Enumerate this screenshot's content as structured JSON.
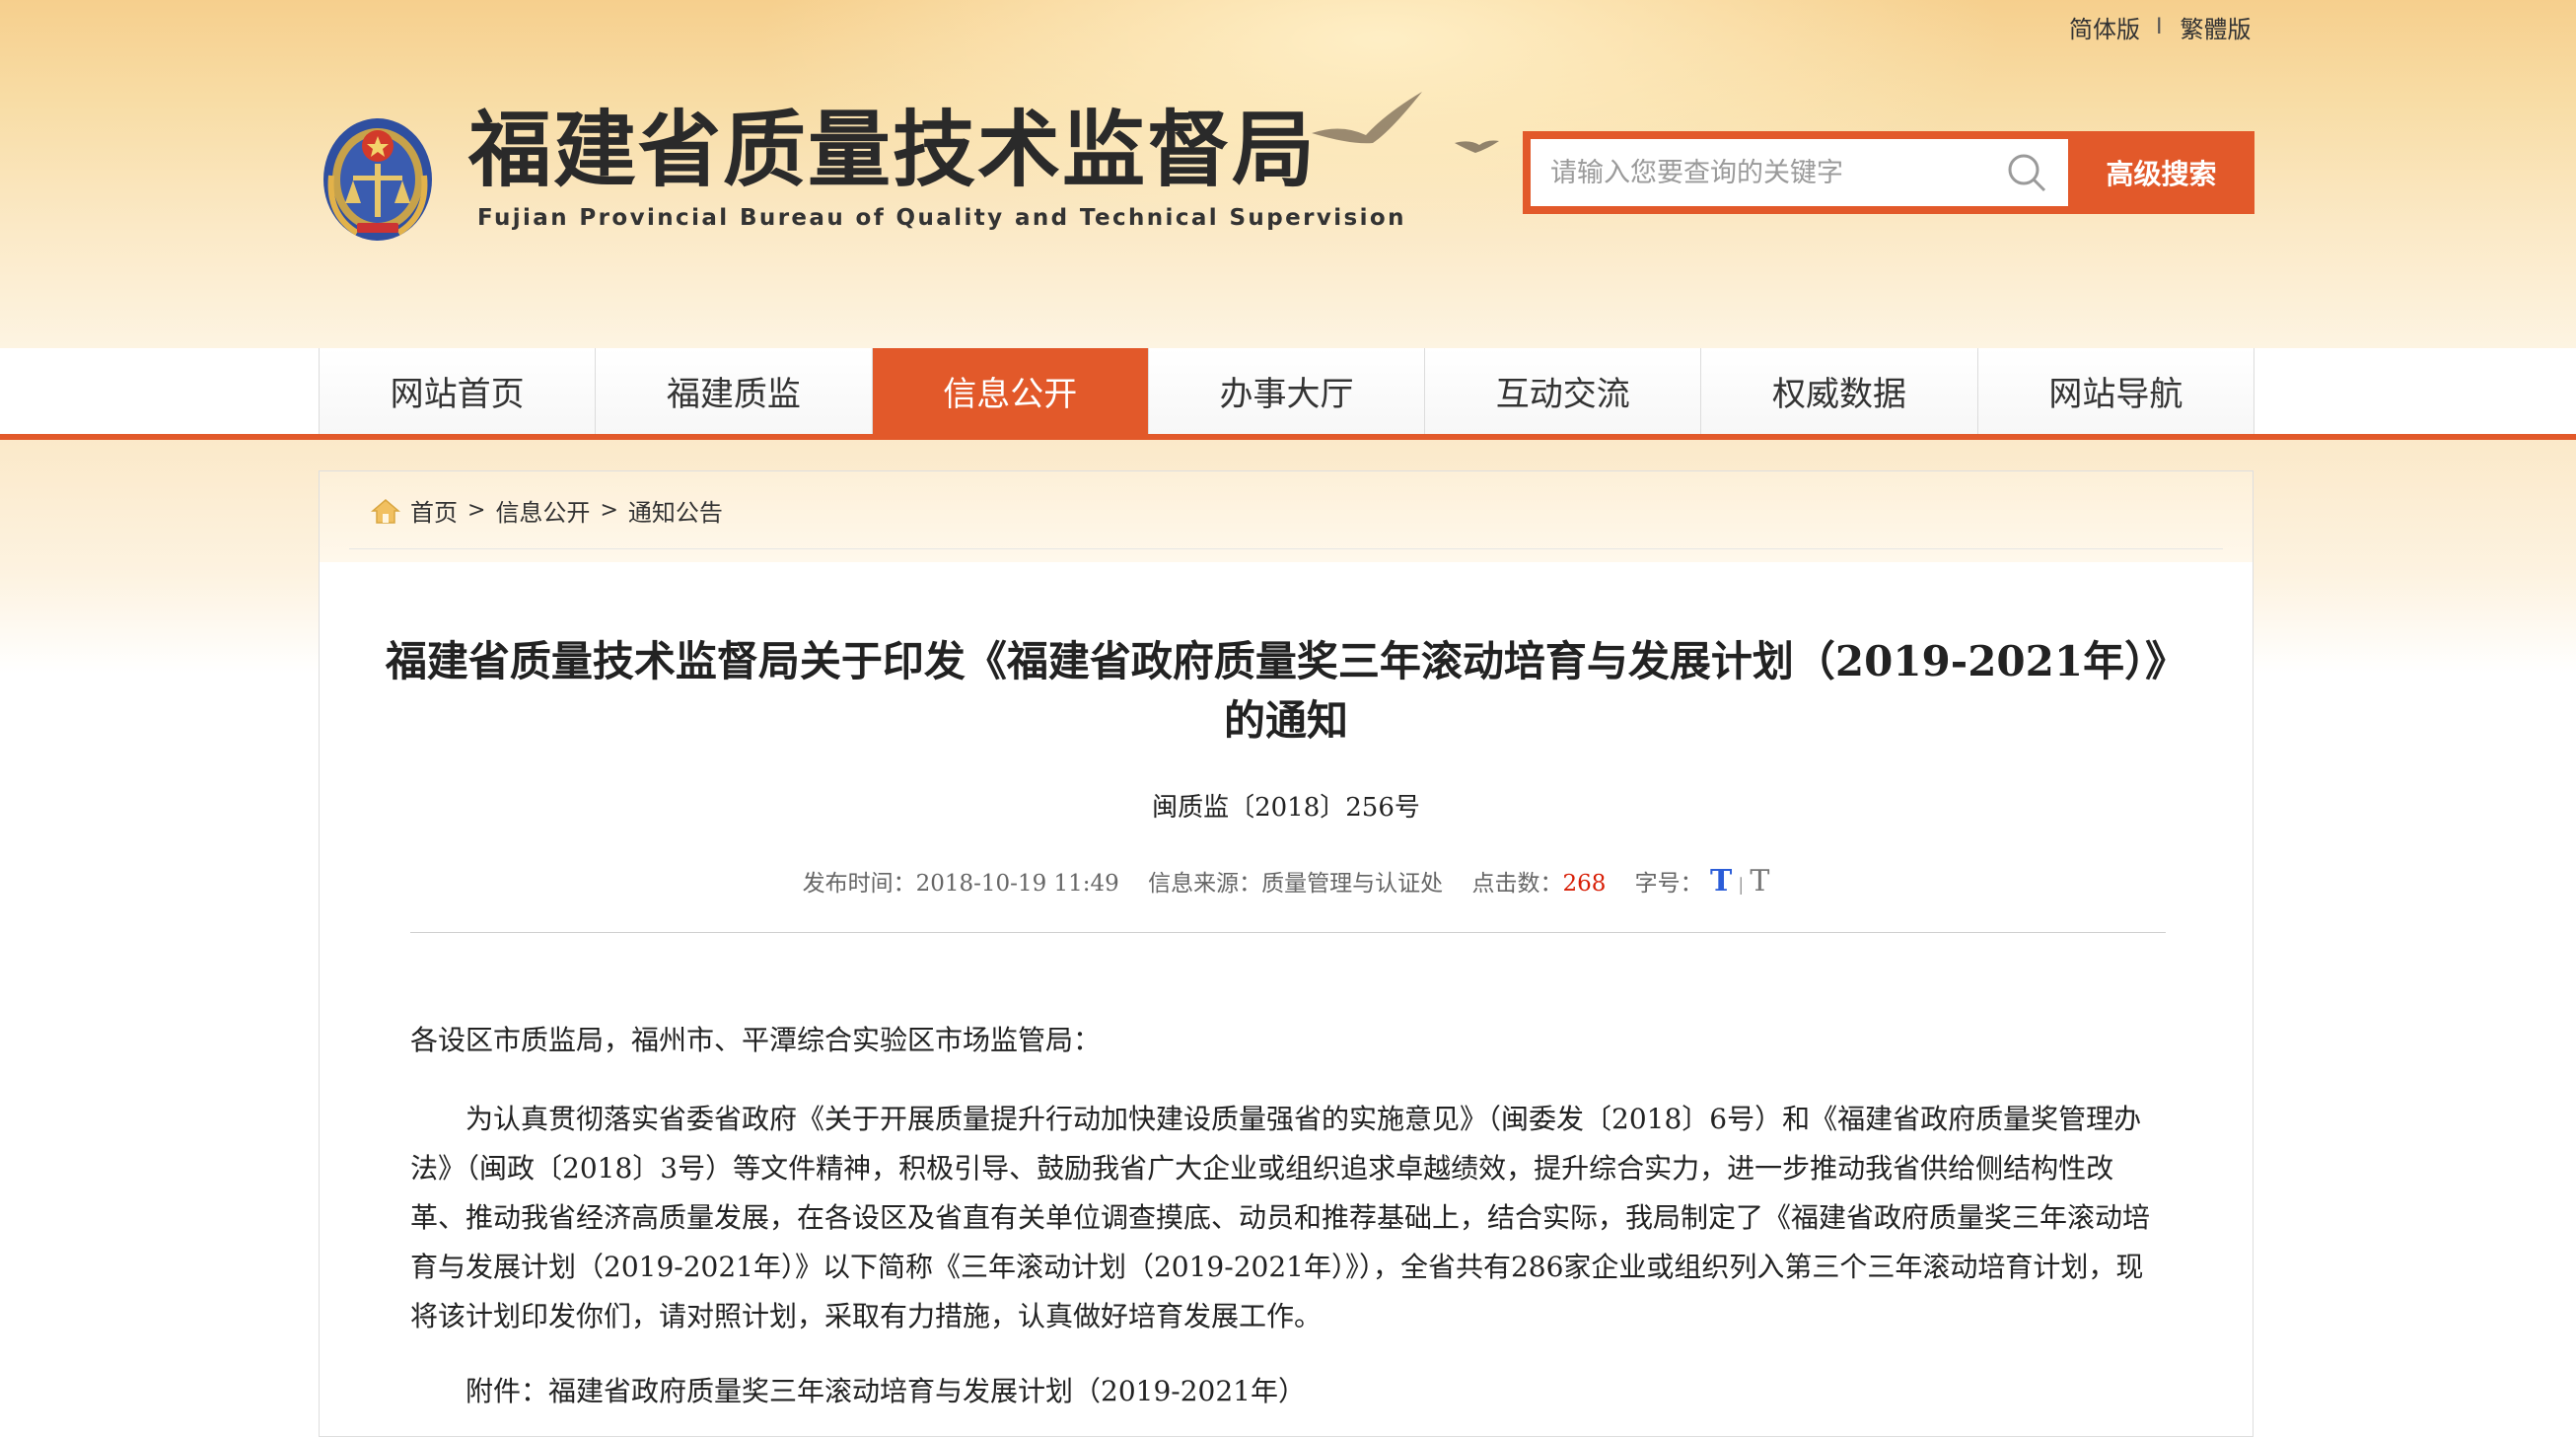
{
  "header": {
    "lang_simplified": "简体版",
    "lang_separator": "I",
    "lang_traditional": "繁體版",
    "site_title": "福建省质量技术监督局",
    "site_subtitle": "Fujian Provincial Bureau of Quality and Technical Supervision",
    "search_placeholder": "请输入您要查询的关键字",
    "search_button": "高级搜索"
  },
  "nav": {
    "items": [
      {
        "label": "网站首页",
        "active": false
      },
      {
        "label": "福建质监",
        "active": false
      },
      {
        "label": "信息公开",
        "active": true
      },
      {
        "label": "办事大厅",
        "active": false
      },
      {
        "label": "互动交流",
        "active": false
      },
      {
        "label": "权威数据",
        "active": false
      },
      {
        "label": "网站导航",
        "active": false
      }
    ]
  },
  "breadcrumb": {
    "home": "首页",
    "sep": ">",
    "level1": "信息公开",
    "level2": "通知公告"
  },
  "article": {
    "title": "福建省质量技术监督局关于印发《福建省政府质量奖三年滚动培育与发展计划（2019-2021年）》的通知",
    "doc_number": "闽质监〔2018〕256号",
    "meta": {
      "publish_label": "发布时间：",
      "publish_value": "2018-10-19 11:49",
      "source_label": "信息来源：",
      "source_value": "质量管理与认证处",
      "clicks_label": "点击数：",
      "clicks_value": "268",
      "font_label": "字号：",
      "font_big": "T",
      "font_sep": "|",
      "font_small": "T"
    },
    "salutation": "各设区市质监局，福州市、平潭综合实验区市场监管局：",
    "paragraph": "　　为认真贯彻落实省委省政府《关于开展质量提升行动加快建设质量强省的实施意见》（闽委发〔2018〕6号）和《福建省政府质量奖管理办法》（闽政〔2018〕3号）等文件精神，积极引导、鼓励我省广大企业或组织追求卓越绩效，提升综合实力，进一步推动我省供给侧结构性改革、推动我省经济高质量发展，在各设区及省直有关单位调查摸底、动员和推荐基础上，结合实际，我局制定了《福建省政府质量奖三年滚动培育与发展计划（2019-2021年）》以下简称《三年滚动计划（2019-2021年）》），全省共有286家企业或组织列入第三个三年滚动培育计划，现将该计划印发你们，请对照计划，采取有力措施，认真做好培育发展工作。",
    "attachment": "　　附件：福建省政府质量奖三年滚动培育与发展计划（2019-2021年）"
  },
  "colors": {
    "accent": "#e2592a",
    "click_count": "#d81e06",
    "font_big": "#2b5dd8"
  }
}
